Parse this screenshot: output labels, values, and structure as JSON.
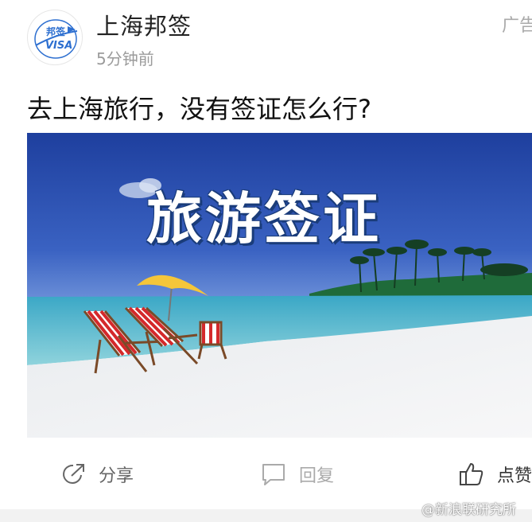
{
  "header": {
    "account_name": "上海邦签",
    "post_time": "5分钟前",
    "ad_label": "广告",
    "avatar_text": "邦签 VISA"
  },
  "post": {
    "title": "去上海旅行，没有签证怎么行?",
    "image_caption": "旅游签证"
  },
  "actions": {
    "share_label": "分享",
    "reply_label": "回复",
    "like_label": "点赞"
  },
  "watermark": "@新浪联研究所",
  "colors": {
    "sky": "#2a4fb0",
    "sea": "#4fb3c8",
    "sand": "#f3f4f6",
    "chair_stripe": "#d4292b",
    "umbrella": "#f5c63a"
  }
}
